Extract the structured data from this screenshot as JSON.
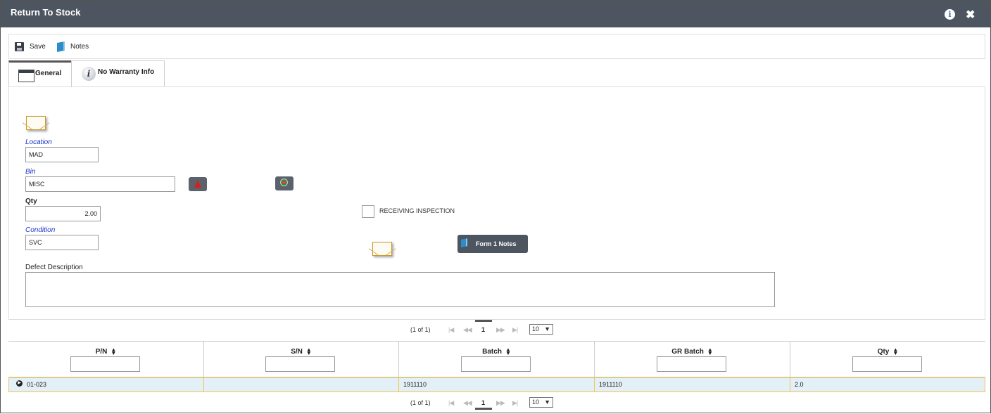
{
  "window": {
    "title": "Return To Stock"
  },
  "toolbar": {
    "save_label": "Save",
    "notes_label": "Notes"
  },
  "tabs": [
    {
      "label": "General",
      "active": true
    },
    {
      "label": "No Warranty Info",
      "active": false
    }
  ],
  "form": {
    "location_label": "Location",
    "location_value": "MAD",
    "bin_label": "Bin",
    "bin_value": "MISC",
    "qty_label": "Qty",
    "qty_value": "2.00",
    "condition_label": "Condition",
    "condition_value": "SVC",
    "receiving_inspection_label": "RECEIVING INSPECTION",
    "receiving_inspection_checked": false,
    "form1_notes_label": "Form 1 Notes",
    "defect_description_label": "Defect Description",
    "defect_description_value": ""
  },
  "pager": {
    "summary": "(1 of 1)",
    "current_page": "1",
    "page_size": "10"
  },
  "grid": {
    "columns": [
      "P/N",
      "S/N",
      "Batch",
      "GR Batch",
      "Qty"
    ],
    "rows": [
      {
        "pn": "01-023",
        "sn": "",
        "batch": "1911110",
        "gr_batch": "1911110",
        "qty": "2.0"
      }
    ]
  },
  "colors": {
    "titlebar": "#4d5560",
    "link_label": "#1a31c9",
    "selected_row": "#e3f0f7",
    "selected_row_border": "#f1c64a"
  }
}
